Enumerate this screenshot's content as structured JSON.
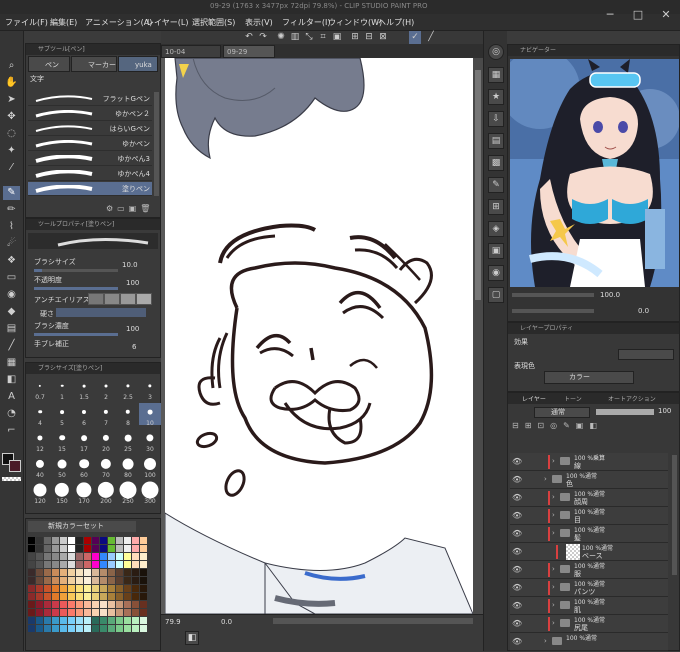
{
  "app": {
    "title": "09-29 (1763 x 3477px 72dpi 79.8%) - CLIP STUDIO PAINT PRO"
  },
  "menu": [
    "ファイル(F)",
    "編集(E)",
    "アニメーション(A)",
    "レイヤー(L)",
    "選択範囲(S)",
    "表示(V)",
    "フィルター(I)",
    "ウィンドウ(W)",
    "ヘルプ(H)"
  ],
  "window_controls": [
    "─",
    "□",
    "✕"
  ],
  "doc_tabs": [
    "10-04",
    "09-29"
  ],
  "subtool": {
    "header": "サブツール[ペン]",
    "tabs": [
      "ペン",
      "マーカー",
      "yuka"
    ],
    "group_label": "文字",
    "brushes": [
      "フラットGペン",
      "ゆかペン２",
      "はらいGペン",
      "ゆかペン",
      "ゆかぺん3",
      "ゆかぺん4",
      "塗りペン"
    ]
  },
  "tool_property": {
    "header": "ツールプロパティ[塗りペン]",
    "brush_size_label": "ブラシサイズ",
    "brush_size_value": "10.0",
    "brush_size_level": 0.1,
    "opacity_label": "不透明度",
    "opacity_value": "100",
    "antialias_label": "アンチエイリアス",
    "hardness_label": "硬さ",
    "density_label": "ブラシ濃度",
    "density_value": "100",
    "stabilize_label": "手ブレ補正",
    "stabilize_value": "6"
  },
  "brush_size_palette": {
    "header": "ブラシサイズ[塗りペン]",
    "sizes": [
      "0.7",
      "1",
      "1.5",
      "2",
      "2.5",
      "3",
      "4",
      "5",
      "6",
      "7",
      "8",
      "10",
      "12",
      "15",
      "17",
      "20",
      "25",
      "30",
      "40",
      "50",
      "60",
      "70",
      "80",
      "100",
      "120",
      "150",
      "170",
      "200",
      "250",
      "300"
    ],
    "selected": "10"
  },
  "color_set": {
    "header": "新規カラーセット"
  },
  "navigator": {
    "header": "ナビゲーター",
    "zoom": "100.0",
    "angle": "0.0"
  },
  "layer_property": {
    "header": "レイヤープロパティ",
    "effect_label": "効果",
    "expression_label": "表現色",
    "expression_value": "カラー"
  },
  "layers": {
    "tabs": [
      "レイヤー",
      "トーン",
      "オートアクション"
    ],
    "blend_mode": "通常",
    "opacity": "100",
    "rows": [
      {
        "pct": "100 %乗算",
        "name": "線",
        "indent": 1
      },
      {
        "pct": "100 %通常",
        "name": "色",
        "indent": 0
      },
      {
        "pct": "100 %通常",
        "name": "顔周",
        "indent": 1
      },
      {
        "pct": "100 %通常",
        "name": "目",
        "indent": 1
      },
      {
        "pct": "100 %通常",
        "name": "髪",
        "indent": 1
      },
      {
        "pct": "100 %通常",
        "name": "ベース",
        "indent": 2
      },
      {
        "pct": "100 %通常",
        "name": "服",
        "indent": 1
      },
      {
        "pct": "100 %通常",
        "name": "パンツ",
        "indent": 1
      },
      {
        "pct": "100 %通常",
        "name": "肌",
        "indent": 1
      },
      {
        "pct": "100 %通常",
        "name": "尻尾",
        "indent": 1
      },
      {
        "pct": "100 %通常",
        "name": "",
        "indent": 0
      }
    ]
  },
  "status": {
    "zoom": "79.9",
    "angle": "0.0"
  }
}
